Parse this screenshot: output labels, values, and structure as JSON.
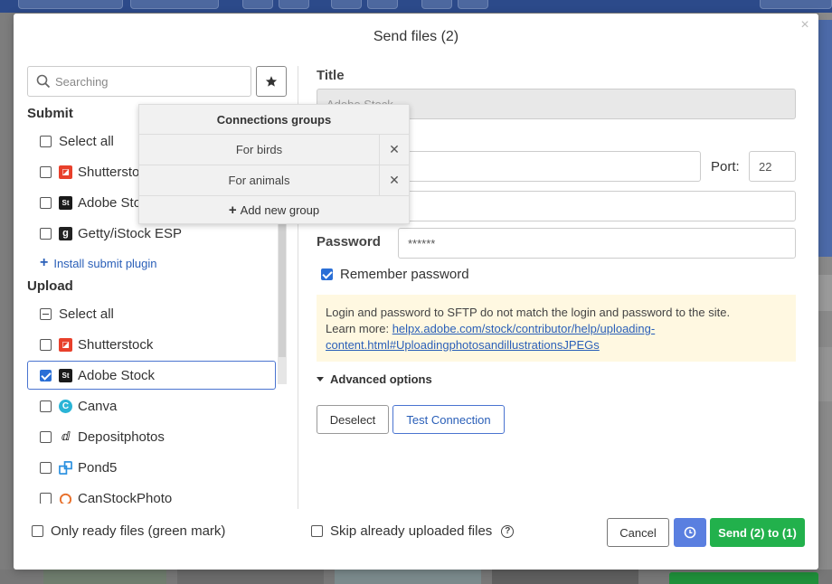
{
  "modal": {
    "title": "Send files (2)",
    "close_icon": "close-icon"
  },
  "search": {
    "placeholder": "Searching"
  },
  "submit": {
    "title": "Submit",
    "select_all": "Select all",
    "items": [
      {
        "label": "Shutterstock",
        "icon": "shutterstock-logo",
        "checked": false
      },
      {
        "label": "Adobe Stock",
        "icon": "adobe-stock-logo",
        "checked": false
      },
      {
        "label": "Getty/iStock ESP",
        "icon": "getty-logo",
        "checked": false
      }
    ],
    "install_link": "Install submit plugin"
  },
  "upload": {
    "title": "Upload",
    "select_all": "Select all",
    "items": [
      {
        "label": "Shutterstock",
        "icon": "shutterstock-logo",
        "checked": false
      },
      {
        "label": "Adobe Stock",
        "icon": "adobe-stock-logo",
        "checked": true
      },
      {
        "label": "Canva",
        "icon": "canva-logo",
        "checked": false
      },
      {
        "label": "Depositphotos",
        "icon": "depositphotos-logo",
        "checked": false
      },
      {
        "label": "Pond5",
        "icon": "pond5-logo",
        "checked": false
      },
      {
        "label": "CanStockPhoto",
        "icon": "canstockphoto-logo",
        "checked": false
      }
    ]
  },
  "popover": {
    "title": "Connections groups",
    "groups": [
      "For birds",
      "For animals"
    ],
    "add_label": "Add new group"
  },
  "form": {
    "title_label": "Title",
    "title_value": "Adobe Stock",
    "port_label": "Port:",
    "port_value": "22",
    "password_label": "Password",
    "password_value": "******",
    "remember_label": "Remember password",
    "remember_checked": true,
    "notice_line1": "Login and password to SFTP do not match the login and password to the site.",
    "notice_learn": "Learn more: ",
    "notice_link": "helpx.adobe.com/stock/contributor/help/uploading-content.html#UploadingphotosandillustrationsJPEGs",
    "notice_link_part1": "helpx.adobe.com/stock/contributor/help/uploading-",
    "notice_link_part2": "content.html#UploadingphotosandillustrationsJPEGs",
    "advanced_label": "Advanced options",
    "deselect_label": "Deselect",
    "test_label": "Test Connection"
  },
  "footer": {
    "only_ready": "Only ready files (green mark)",
    "skip_uploaded": "Skip already uploaded files",
    "cancel_label": "Cancel",
    "send_label": "Send (2) to (1)"
  },
  "colors": {
    "accent": "#4a74d0",
    "send": "#22b14c",
    "clock": "#5a7fe0",
    "notice_bg": "#fff8e1"
  }
}
